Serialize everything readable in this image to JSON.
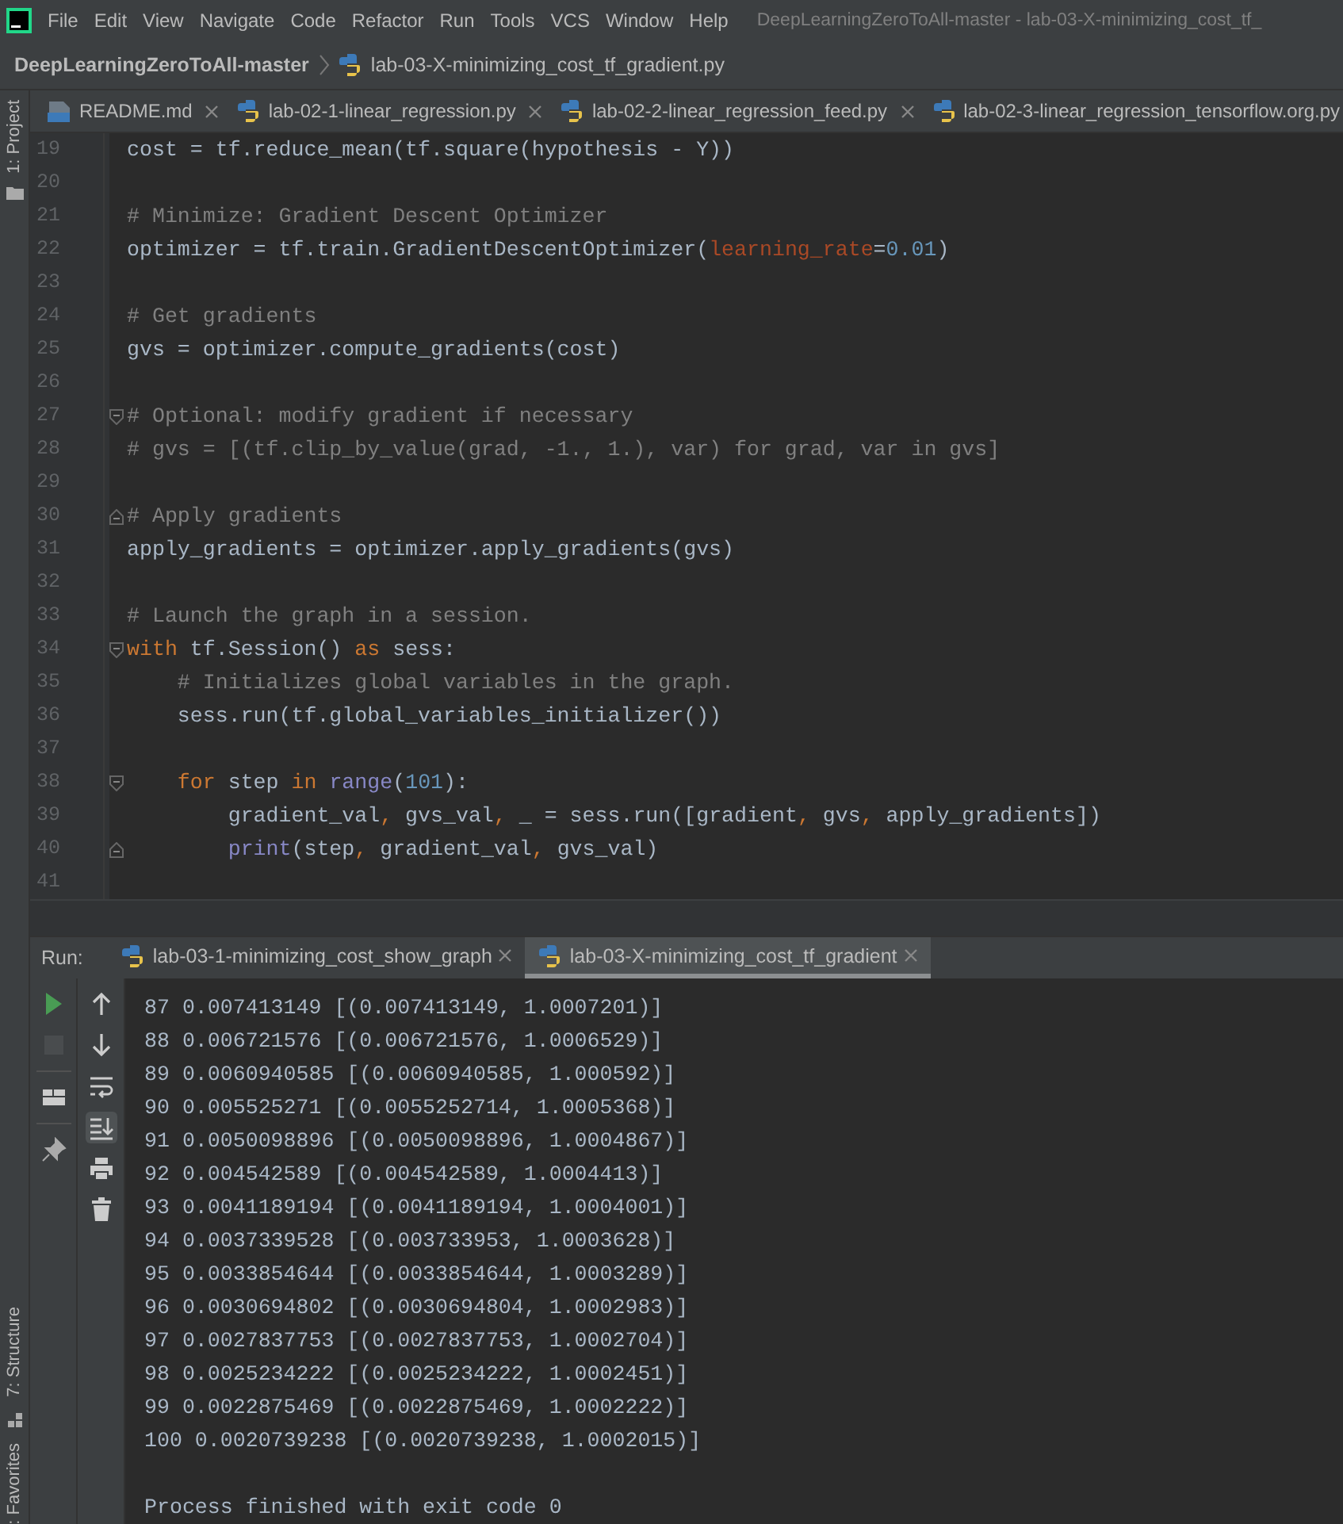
{
  "menu_bar": {
    "items": [
      "File",
      "Edit",
      "View",
      "Navigate",
      "Code",
      "Refactor",
      "Run",
      "Tools",
      "VCS",
      "Window",
      "Help"
    ],
    "title": "DeepLearningZeroToAll-master - lab-03-X-minimizing_cost_tf_"
  },
  "breadcrumb": [
    "DeepLearningZeroToAll-master",
    "lab-03-X-minimizing_cost_tf_gradient.py"
  ],
  "side_tools": {
    "top": [
      {
        "label": "1: Project"
      }
    ],
    "bottom": [
      {
        "label": "7: Structure"
      },
      {
        "label": ": Favorites"
      }
    ]
  },
  "editor_tabs": [
    {
      "label": "README.md",
      "kind": "md",
      "selected": false,
      "closable": true
    },
    {
      "label": "lab-02-1-linear_regression.py",
      "kind": "py",
      "selected": false,
      "closable": true
    },
    {
      "label": "lab-02-2-linear_regression_feed.py",
      "kind": "py",
      "selected": false,
      "closable": true
    },
    {
      "label": "lab-02-3-linear_regression_tensorflow.org.py",
      "kind": "py",
      "selected": false,
      "closable": false
    }
  ],
  "editor": {
    "lines": [
      {
        "number": "19",
        "tokens": [
          {
            "text": "cost = tf.reduce_mean(tf.square(hypothesis - Y))",
            "kind": "plain"
          }
        ]
      },
      {
        "number": "20"
      },
      {
        "number": "21",
        "tokens": [
          {
            "text": "# Minimize: Gradient Descent Optimizer",
            "kind": "comment"
          }
        ]
      },
      {
        "number": "22",
        "tokens": [
          {
            "text": "optimizer = tf.train.GradientDescentOptimizer(",
            "kind": "plain"
          },
          {
            "text": "learning_rate",
            "kind": "param"
          },
          {
            "text": "=",
            "kind": "plain"
          },
          {
            "text": "0.01",
            "kind": "number"
          },
          {
            "text": ")",
            "kind": "plain"
          }
        ]
      },
      {
        "number": "23"
      },
      {
        "number": "24",
        "tokens": [
          {
            "text": "# Get gradients",
            "kind": "comment"
          }
        ]
      },
      {
        "number": "25",
        "tokens": [
          {
            "text": "gvs = optimizer.compute_gradients(cost)",
            "kind": "plain"
          }
        ]
      },
      {
        "number": "26"
      },
      {
        "number": "27",
        "fold_start": true,
        "tokens": [
          {
            "text": "# Optional: modify gradient if necessary",
            "kind": "comment"
          }
        ]
      },
      {
        "number": "28",
        "tokens": [
          {
            "text": "# gvs = [(tf.clip_by_value(grad, -1., 1.), var) for grad, var in gvs]",
            "kind": "comment"
          }
        ]
      },
      {
        "number": "29"
      },
      {
        "number": "30",
        "fold_end": true,
        "tokens": [
          {
            "text": "# Apply gradients",
            "kind": "comment"
          }
        ]
      },
      {
        "number": "31",
        "tokens": [
          {
            "text": "apply_gradients = optimizer.apply_gradients(gvs)",
            "kind": "plain"
          }
        ]
      },
      {
        "number": "32"
      },
      {
        "number": "33",
        "tokens": [
          {
            "text": "# Launch the graph in a session.",
            "kind": "comment"
          }
        ]
      },
      {
        "number": "34",
        "fold_start": true,
        "tokens": [
          {
            "text": "with",
            "kind": "keyword"
          },
          {
            "text": " tf.Session() ",
            "kind": "plain"
          },
          {
            "text": "as",
            "kind": "keyword"
          },
          {
            "text": " sess:",
            "kind": "plain"
          }
        ]
      },
      {
        "number": "35",
        "tokens": [
          {
            "text": "    # Initializes global variables in the graph.",
            "kind": "comment"
          }
        ]
      },
      {
        "number": "36",
        "tokens": [
          {
            "text": "    sess.run(tf.global_variables_initializer())",
            "kind": "plain"
          }
        ]
      },
      {
        "number": "37"
      },
      {
        "number": "38",
        "fold_start": true,
        "tokens": [
          {
            "text": "    for",
            "kind": "keyword"
          },
          {
            "text": " step ",
            "kind": "plain"
          },
          {
            "text": "in",
            "kind": "keyword"
          },
          {
            "text": " range",
            "kind": "builtin"
          },
          {
            "text": "(",
            "kind": "plain"
          },
          {
            "text": "101",
            "kind": "number"
          },
          {
            "text": "):",
            "kind": "plain"
          }
        ]
      },
      {
        "number": "39",
        "tokens": [
          {
            "text": "        gradient_val",
            "kind": "plain"
          },
          {
            "text": ",",
            "kind": "keyword"
          },
          {
            "text": " gvs_val",
            "kind": "plain"
          },
          {
            "text": ",",
            "kind": "keyword"
          },
          {
            "text": " _ = sess.run([gradient",
            "kind": "plain"
          },
          {
            "text": ",",
            "kind": "keyword"
          },
          {
            "text": " gvs",
            "kind": "plain"
          },
          {
            "text": ",",
            "kind": "keyword"
          },
          {
            "text": " apply_gradients])",
            "kind": "plain"
          }
        ]
      },
      {
        "number": "40",
        "fold_end": true,
        "tokens": [
          {
            "text": "        print",
            "kind": "builtin"
          },
          {
            "text": "(step",
            "kind": "plain"
          },
          {
            "text": ",",
            "kind": "keyword"
          },
          {
            "text": " gradient_val",
            "kind": "plain"
          },
          {
            "text": ",",
            "kind": "keyword"
          },
          {
            "text": " gvs_val)",
            "kind": "plain"
          }
        ]
      },
      {
        "number": "41"
      }
    ]
  },
  "run_panel": {
    "label": "Run:",
    "tabs": [
      {
        "label": "lab-03-1-minimizing_cost_show_graph",
        "selected": false
      },
      {
        "label": "lab-03-X-minimizing_cost_tf_gradient",
        "selected": true
      }
    ],
    "primary_tools": [
      {
        "kind": "run",
        "disabled": false
      },
      {
        "kind": "stop",
        "disabled": true
      },
      {
        "kind": "layout",
        "disabled": false
      },
      {
        "kind": "pin",
        "disabled": false
      }
    ],
    "secondary_tools": [
      {
        "kind": "up",
        "on": false
      },
      {
        "kind": "down",
        "on": false
      },
      {
        "kind": "wrap",
        "on": false
      },
      {
        "kind": "scroll",
        "on": true
      },
      {
        "kind": "print",
        "on": false
      },
      {
        "kind": "trash",
        "on": false
      }
    ],
    "output": [
      "87 0.007413149 [(0.007413149, 1.0007201)]",
      "88 0.006721576 [(0.006721576, 1.0006529)]",
      "89 0.0060940585 [(0.0060940585, 1.000592)]",
      "90 0.005525271 [(0.0055252714, 1.0005368)]",
      "91 0.0050098896 [(0.0050098896, 1.0004867)]",
      "92 0.004542589 [(0.004542589, 1.0004413)]",
      "93 0.0041189194 [(0.0041189194, 1.0004001)]",
      "94 0.0037339528 [(0.003733953, 1.0003628)]",
      "95 0.0033854644 [(0.0033854644, 1.0003289)]",
      "96 0.0030694802 [(0.0030694804, 1.0002983)]",
      "97 0.0027837753 [(0.0027837753, 1.0002704)]",
      "98 0.0025234222 [(0.0025234222, 1.0002451)]",
      "99 0.0022875469 [(0.0022875469, 1.0002222)]",
      "100 0.0020739238 [(0.0020739238, 1.0002015)]"
    ],
    "exit_message": "Process finished with exit code 0"
  }
}
